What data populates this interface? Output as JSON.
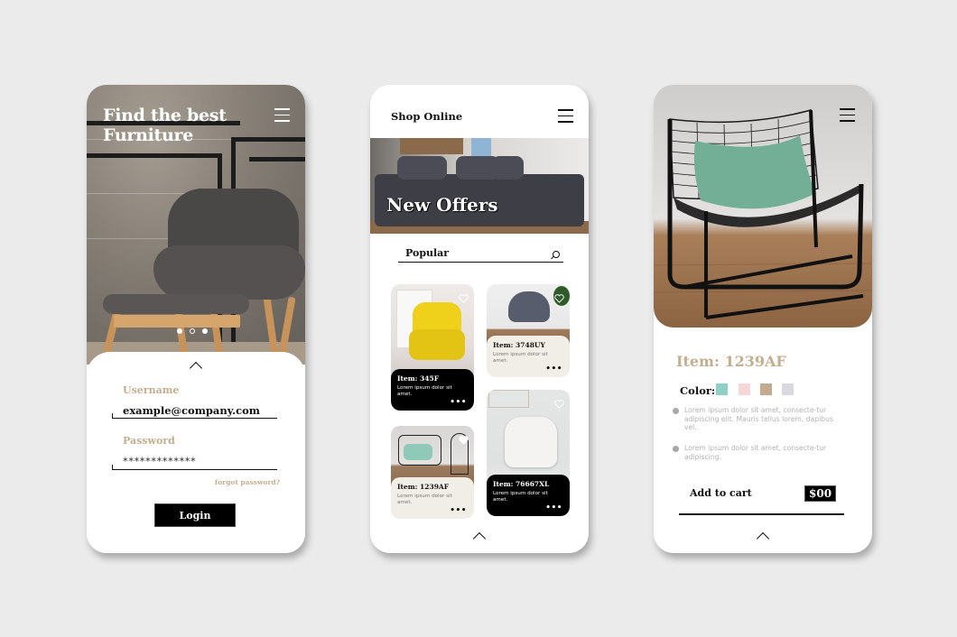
{
  "login_screen": {
    "title_line1": "Find the best",
    "title_line2": "Furniture",
    "menu_icon": "hamburger-icon",
    "carousel": {
      "count": 3,
      "active_index": 1
    },
    "expand_icon": "chevron-up-icon",
    "username": {
      "label": "Username",
      "value": "example@company.com"
    },
    "password": {
      "label": "Password",
      "value": "*************"
    },
    "forgot_link": "forgot password?",
    "login_button": "Login",
    "accent_color": "#c3ae90"
  },
  "shop_screen": {
    "title": "Shop Online",
    "menu_icon": "hamburger-icon",
    "banner_title": "New Offers",
    "search": {
      "value": "Popular",
      "icon": "search-icon"
    },
    "products": [
      {
        "name": "Item: 345F",
        "desc": "Lorem ipsum dolor sit amet.",
        "style": "dark",
        "more": "•••"
      },
      {
        "name": "Item: 3748UY",
        "desc": "Lorem ipsum dolor sit amet.",
        "style": "light",
        "more": "•••"
      },
      {
        "name": "Item: 1239AF",
        "desc": "Lorem ipsum dolor sit amet.",
        "style": "light",
        "more": "•••"
      },
      {
        "name": "Item: 76667XL",
        "desc": "Lorem ipsum dolor sit amet.",
        "style": "dark",
        "more": "•••"
      }
    ],
    "expand_icon": "chevron-up-icon"
  },
  "detail_screen": {
    "menu_icon": "hamburger-icon",
    "item_title": "Item: 1239AF",
    "color_label": "Color:",
    "swatches": [
      "#8fd0c6",
      "#f6d6d6",
      "#c3ab8f",
      "#d9d9e0"
    ],
    "bullets": [
      "Lorem ipsum dolor sit amet, consecte-tur adipiscing elit. Mauris tellus lorem, dapibus vel.",
      "Lorem ipsum dolor sit amet, consecte-tur adipiscing."
    ],
    "add_to_cart": "Add to cart",
    "price": "$00",
    "expand_icon": "chevron-up-icon"
  }
}
